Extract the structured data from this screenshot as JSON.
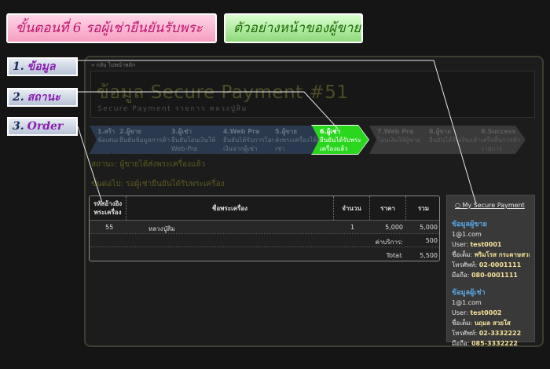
{
  "banners": {
    "step_title": "ขั้นตอนที่ 6  รอผู้เช่ายืนยันรับพระ",
    "example": "ตัวอย่างหน้าของผู้ขาย"
  },
  "callouts": [
    {
      "num": "1.",
      "text": "ข้อมูล"
    },
    {
      "num": "2.",
      "text": "สถานะ"
    },
    {
      "num": "3.",
      "text": "Order"
    }
  ],
  "page": {
    "back_link": "« กลับ ไปหน้าหลัก",
    "title": "ข้อมูล Secure Payment #51",
    "subtitle": "Secure Payment รายการ หลวงปู่สิม"
  },
  "steps": [
    {
      "label": "1.สร้าง",
      "desc": "ข้อเสนอ",
      "state": "done"
    },
    {
      "label": "2.ผู้ขาย",
      "desc": "ยืนยันข้อมูลการค้า",
      "state": "done"
    },
    {
      "label": "3.ผู้เช่า",
      "desc": "ยืนยันโอนเงินให้ Web-Pra",
      "state": "done"
    },
    {
      "label": "4.Web Pra",
      "desc": "ยืนยันได้รับการโอนเงินจากผู้เช่า",
      "state": "done"
    },
    {
      "label": "5.ผู้ขาย",
      "desc": "ส่งพระเครื่องให้ผู้เช่า",
      "state": "done"
    },
    {
      "label": "6.ผู้เช่า",
      "desc": "ยืนยันได้รับพระเครื่องแล้ว",
      "state": "active"
    },
    {
      "label": "7.Web Pra",
      "desc": "โอนเงินให้ผู้ขาย",
      "state": "todo"
    },
    {
      "label": "8.ผู้ขาย",
      "desc": "ยืนยันได้รับเงินแล้ว",
      "state": "todo"
    },
    {
      "label": "9.Success",
      "desc": "เสร็จสิ้นการทำรายการ",
      "state": "todo"
    }
  ],
  "status": {
    "current": "สถานะ: ผู้ขายได้ส่งพระเครื่องแล้ว",
    "next": "ขั้นต่อไป: รอผู้เช่ายืนยันได้รับพระเครื่อง"
  },
  "order": {
    "headers": [
      "รหัสอ้างอิงพระเครื่อง",
      "ชื่อพระเครื่อง",
      "จำนวน",
      "ราคา",
      "รวม"
    ],
    "item": {
      "code": "55",
      "name": "หลวงปู่สิม",
      "qty": "1",
      "price": "5,000",
      "total": "5,000"
    },
    "fee_label": "ค่าบริการ:",
    "fee_value": "500",
    "total_label": "Total:",
    "total_value": "5,500"
  },
  "sidebar": {
    "link": "My Secure Payment",
    "seller": {
      "heading": "ข้อมูลผู้ขาย",
      "email": "1@1.com",
      "user_label": "User:",
      "user": "test0001",
      "name_label": "ชื่อเต็ม:",
      "name": "พริมโรส กระดาษสวย",
      "phone_label": "โทรศัพท์:",
      "phone": "02-0001111",
      "mobile_label": "มือถือ:",
      "mobile": "080-0001111"
    },
    "buyer": {
      "heading": "ข้อมูลผู้เช่า",
      "email": "1@1.com",
      "user_label": "User:",
      "user": "test0002",
      "name_label": "ชื่อเต็ม:",
      "name": "นฤมล สวยใส",
      "phone_label": "โทรศัพท์:",
      "phone": "02-3332222",
      "mobile_label": "มือถือ:",
      "mobile": "085-3332222"
    }
  }
}
